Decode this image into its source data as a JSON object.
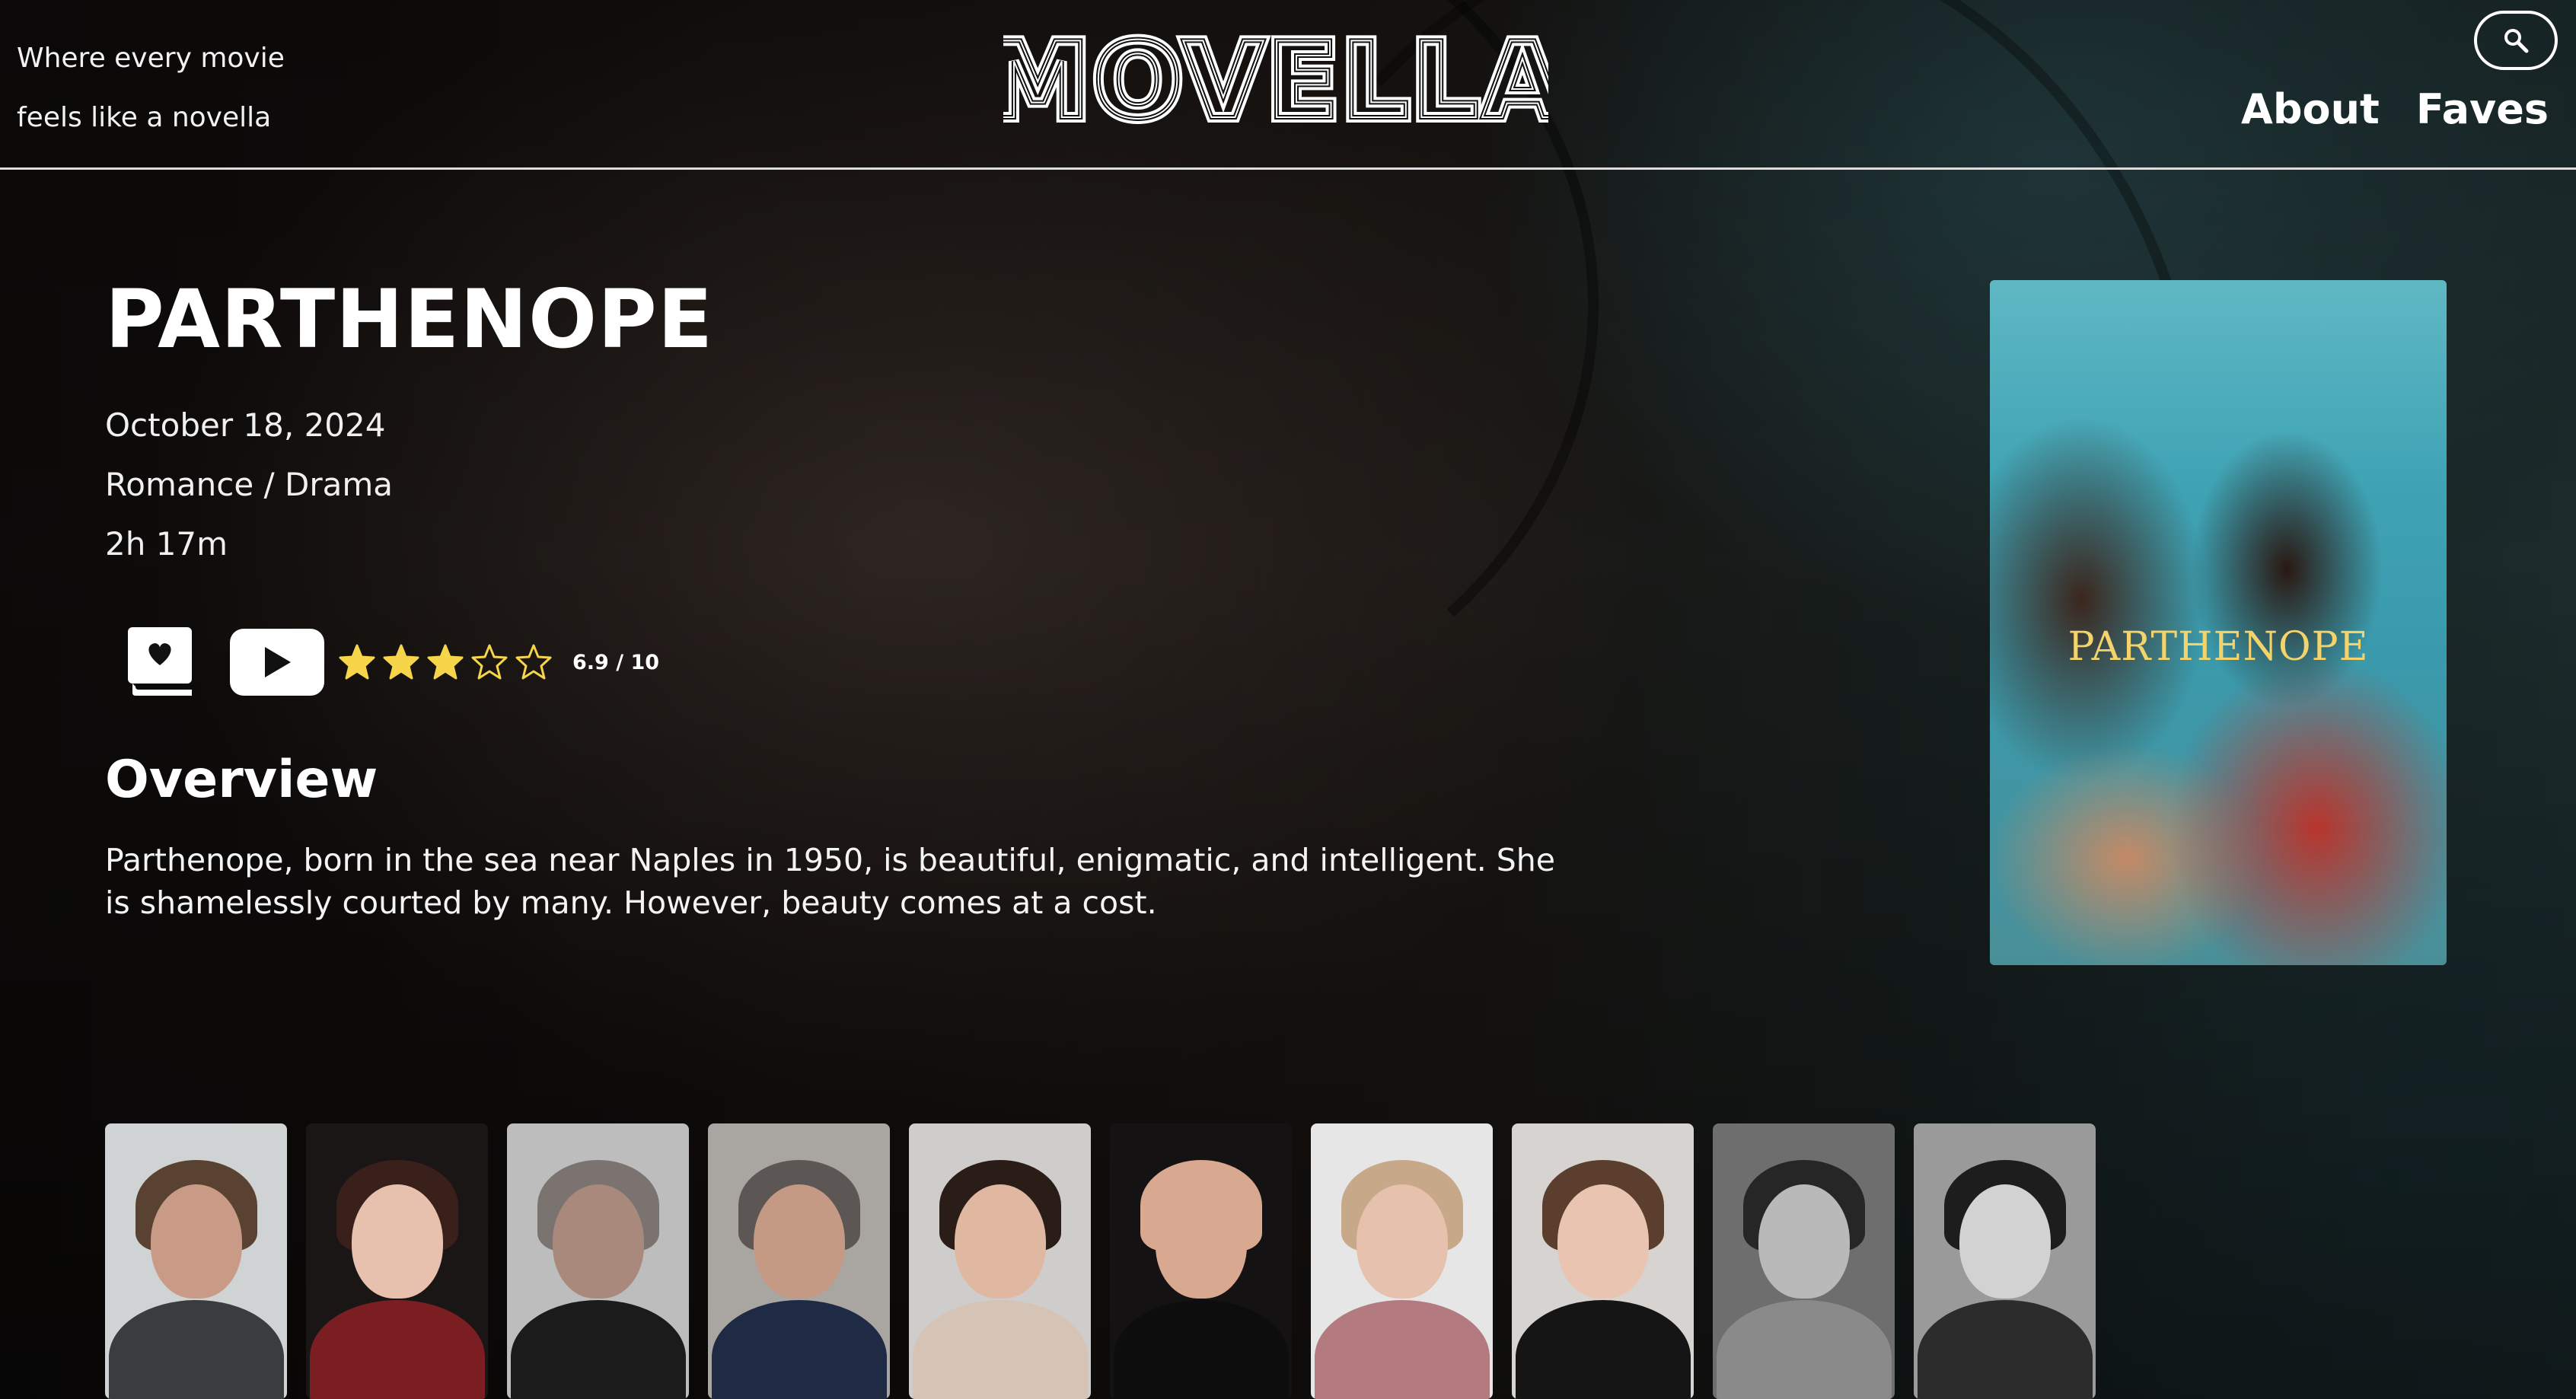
{
  "app": {
    "logo_text": "MOVELLA",
    "tagline_line1": "Where every movie",
    "tagline_line2": "feels like a novella"
  },
  "header": {
    "search_icon": "search-icon",
    "nav": [
      {
        "label": "About"
      },
      {
        "label": "Faves"
      }
    ]
  },
  "movie": {
    "title": "PARTHENOPE",
    "release_date": "October 18, 2024",
    "genres": "Romance / Drama",
    "runtime": "2h 17m",
    "rating_text": "6.9 / 10",
    "rating_stars_filled": 3,
    "rating_stars_total": 5,
    "overview_heading": "Overview",
    "overview": "Parthenope, born in the sea near Naples in 1950, is beautiful, enigmatic, and intelligent. She is shamelessly courted by many. However, beauty comes at a cost.",
    "poster_title": "PARTHENOPE"
  },
  "cast": [
    {
      "bg": "#cfd3d3",
      "skin": "#c99a86",
      "hair": "#5a4232",
      "body": "#3a3c3e"
    },
    {
      "bg": "#1b1616",
      "skin": "#e8c1ae",
      "hair": "#3a201a",
      "body": "#7a1e22"
    },
    {
      "bg": "#bdbdbd",
      "skin": "#a8897c",
      "hair": "#7a7370",
      "body": "#1b1b1b"
    },
    {
      "bg": "#a9a6a2",
      "skin": "#c49a84",
      "hair": "#5c5754",
      "body": "#1f2a44"
    },
    {
      "bg": "#cfcdcb",
      "skin": "#e0b7a0",
      "hair": "#2a1c17",
      "body": "#d5c3b6"
    },
    {
      "bg": "#141212",
      "skin": "#d8a890",
      "hair": "#d8a890",
      "body": "#0d0d0d"
    },
    {
      "bg": "#e6e6e6",
      "skin": "#e6c1ad",
      "hair": "#c7a98a",
      "body": "#b37a7f"
    },
    {
      "bg": "#d6d3d0",
      "skin": "#e9c5b1",
      "hair": "#5b3e2e",
      "body": "#151515"
    },
    {
      "bg": "#6e6e6e",
      "skin": "#b9b9b9",
      "hair": "#262626",
      "body": "#8a8a8a"
    },
    {
      "bg": "#9a9a9a",
      "skin": "#d2d2d2",
      "hair": "#1d1d1d",
      "body": "#2c2c2c"
    }
  ],
  "colors": {
    "star": "#f6d54a",
    "accent_white": "#ffffff"
  }
}
